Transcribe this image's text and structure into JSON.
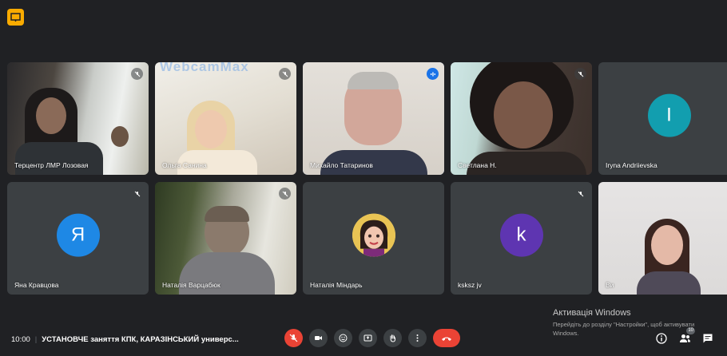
{
  "app_icon": "presentation-icon",
  "tiles": [
    {
      "name": "Терцентр ЛМР Лозовая",
      "mic": "muted",
      "kind": "video"
    },
    {
      "name": "Ольга Санина",
      "mic": "muted",
      "kind": "video",
      "watermark": "WebcamMax"
    },
    {
      "name": "Михайло Татаринов",
      "mic": "active",
      "kind": "video"
    },
    {
      "name": "Светлана Н.",
      "mic": "muted",
      "kind": "video"
    },
    {
      "name": "Iryna Andriievska",
      "mic": "none",
      "kind": "avatar",
      "letter": "I",
      "color": "#129eaf"
    },
    {
      "name": "Яна Кравцова",
      "mic": "muted",
      "kind": "avatar",
      "letter": "Я",
      "color": "#1e88e5"
    },
    {
      "name": "Наталія Варцабюк",
      "mic": "muted",
      "kind": "video"
    },
    {
      "name": "Наталія Міндарь",
      "mic": "none",
      "kind": "avatar-photo"
    },
    {
      "name": "ksksz jv",
      "mic": "muted",
      "kind": "avatar",
      "letter": "k",
      "color": "#5e35b1"
    },
    {
      "name": "Ви",
      "mic": "none",
      "kind": "video"
    }
  ],
  "meeting": {
    "time": "10:00",
    "title": "УСТАНОВЧЕ заняття КПК, КАРАЗІНСЬКИЙ универс..."
  },
  "controls": [
    "mic-off-icon",
    "camera-icon",
    "emoji-icon",
    "present-icon",
    "raise-hand-icon",
    "more-icon",
    "hangup-icon"
  ],
  "windows_activation": {
    "title": "Активація Windows",
    "text": "Перейдіть до розділу \"Настройки\", щоб активувати Windows."
  },
  "right_icons": {
    "info": "info-icon",
    "people": "people-icon",
    "people_count": "10",
    "chat": "chat-icon"
  },
  "colors": {
    "background": "#202124",
    "tile": "#3c4043",
    "accent": "#8ab4f8",
    "danger": "#ea4335"
  }
}
